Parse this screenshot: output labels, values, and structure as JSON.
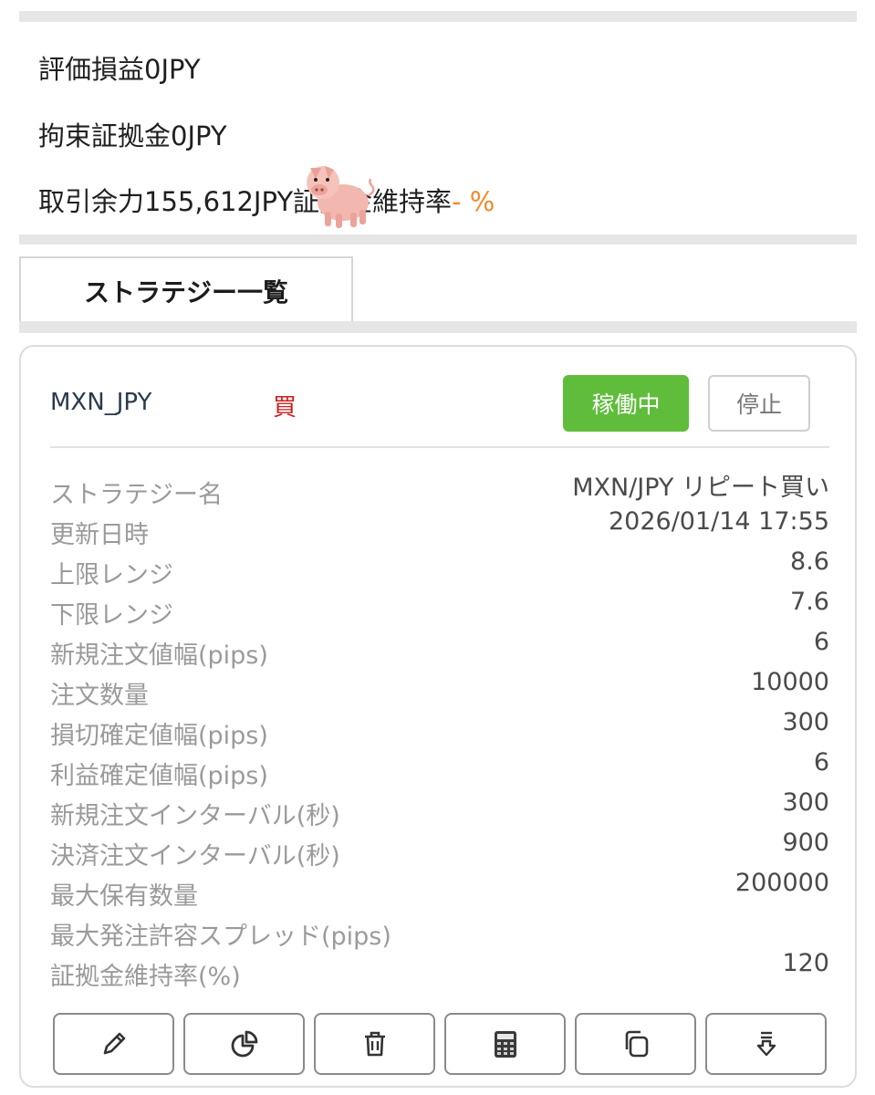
{
  "summary": {
    "valuation_pl": "評価損益0JPY",
    "margin_held": "拘束証拠金0JPY",
    "available": "取引余力155,612JPY",
    "maintenance_label": "証拠金維持率",
    "maintenance_value": "- %"
  },
  "tab": {
    "label": "ストラテジー一覧"
  },
  "strategy": {
    "pair": "MXN_JPY",
    "side": "買",
    "running_label": "稼働中",
    "stop_label": "停止",
    "rows": [
      {
        "key": "ストラテジー名",
        "value": "MXN/JPY リピート買い"
      },
      {
        "key": "更新日時",
        "value": "2026/01/14 17:55"
      },
      {
        "key": "上限レンジ",
        "value": "8.6"
      },
      {
        "key": "下限レンジ",
        "value": "7.6"
      },
      {
        "key": "新規注文値幅(pips)",
        "value": "6"
      },
      {
        "key": "注文数量",
        "value": "10000"
      },
      {
        "key": "損切確定値幅(pips)",
        "value": "300"
      },
      {
        "key": "利益確定値幅(pips)",
        "value": "6"
      },
      {
        "key": "新規注文インターバル(秒)",
        "value": "300"
      },
      {
        "key": "決済注文インターバル(秒)",
        "value": "900"
      },
      {
        "key": "最大保有数量",
        "value": "200000"
      },
      {
        "key": "最大発注許容スプレッド(pips)",
        "value": ""
      },
      {
        "key": "証拠金維持率(%)",
        "value": "120"
      }
    ]
  },
  "actions": [
    {
      "icon": "pencil-icon"
    },
    {
      "icon": "pie-chart-icon"
    },
    {
      "icon": "trash-icon"
    },
    {
      "icon": "calculator-icon"
    },
    {
      "icon": "copy-icon"
    },
    {
      "icon": "download-icon"
    }
  ],
  "colors": {
    "running": "#5fbd3b",
    "buy": "#c81e1e",
    "accent": "#f08a2c"
  }
}
